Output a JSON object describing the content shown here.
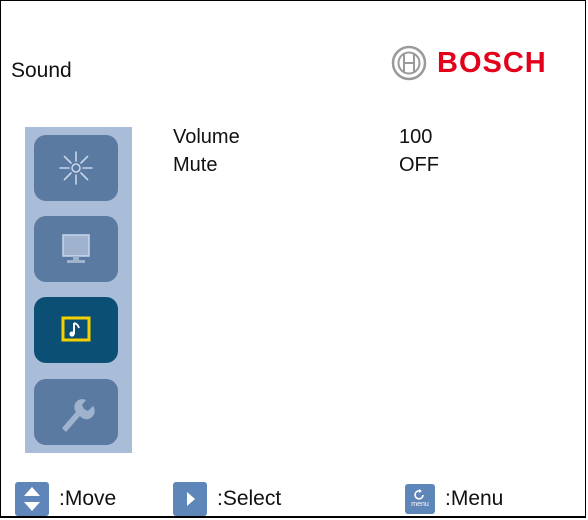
{
  "header": {
    "title": "Sound",
    "brand": "BOSCH",
    "brand_color": "#e2001a"
  },
  "sidebar": {
    "items": [
      {
        "icon": "brightness-icon",
        "active": false
      },
      {
        "icon": "monitor-icon",
        "active": false
      },
      {
        "icon": "sound-icon",
        "active": true
      },
      {
        "icon": "wrench-icon",
        "active": false
      }
    ],
    "background": "#a9bcd8",
    "tile_color": "#5a7aa2",
    "active_tile_color": "#0c4f75"
  },
  "menu": {
    "rows": [
      {
        "label": "Volume",
        "value": "100"
      },
      {
        "label": "Mute",
        "value": "OFF"
      }
    ]
  },
  "footer": {
    "move": {
      "icon": "up-down-arrows-icon",
      "label": ":Move"
    },
    "select": {
      "icon": "right-arrow-icon",
      "label": ":Select"
    },
    "menu": {
      "icon": "menu-icon",
      "label": ":Menu",
      "icon_text": "menu"
    }
  }
}
